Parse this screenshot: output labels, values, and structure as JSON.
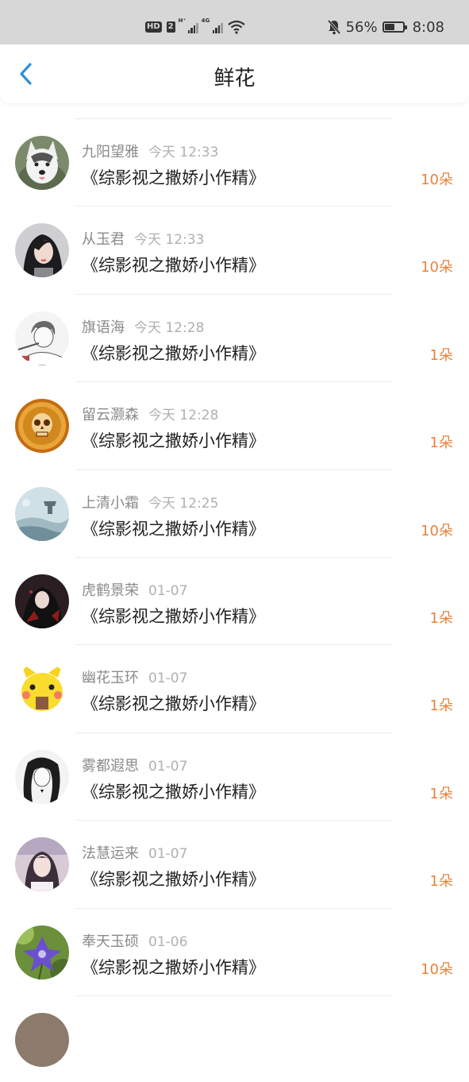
{
  "status_bar": {
    "hd_label": "HD",
    "hd_sub": "2",
    "signal_a_label": "H⁺",
    "signal_b_label": "4G",
    "battery_text": "56%",
    "battery_level": 0.56,
    "time": "8:08",
    "icons": [
      "hd-icon",
      "signal-icon",
      "wifi-icon",
      "mute-bell-icon",
      "battery-icon"
    ]
  },
  "header": {
    "title": "鲜花",
    "back_icon": "chevron-left-icon",
    "accent_color": "#2d8fe0"
  },
  "amount_color": "#e8833a",
  "entries": [
    {
      "name": "九阳望雅",
      "time": "今天 12:33",
      "book": "《综影视之撒娇小作精》",
      "amount": "10朵",
      "avatar": "husky-dog"
    },
    {
      "name": "从玉君",
      "time": "今天 12:33",
      "book": "《综影视之撒娇小作精》",
      "amount": "10朵",
      "avatar": "girl-portrait"
    },
    {
      "name": "旗语海",
      "time": "今天 12:28",
      "book": "《综影视之撒娇小作精》",
      "amount": "1朵",
      "avatar": "sketch-boy"
    },
    {
      "name": "留云灏森",
      "time": "今天 12:28",
      "book": "《综影视之撒娇小作精》",
      "amount": "1朵",
      "avatar": "golden-skull"
    },
    {
      "name": "上清小霜",
      "time": "今天 12:25",
      "book": "《综影视之撒娇小作精》",
      "amount": "10朵",
      "avatar": "misty-landscape"
    },
    {
      "name": "虎鹤景荣",
      "time": "01-07",
      "book": "《综影视之撒娇小作精》",
      "amount": "1朵",
      "avatar": "dark-ancient-figure"
    },
    {
      "name": "幽花玉环",
      "time": "01-07",
      "book": "《综影视之撒娇小作精》",
      "amount": "1朵",
      "avatar": "yellow-cartoon"
    },
    {
      "name": "雾都遐思",
      "time": "01-07",
      "book": "《综影视之撒娇小作精》",
      "amount": "1朵",
      "avatar": "bw-sketch-girl"
    },
    {
      "name": "法慧运来",
      "time": "01-07",
      "book": "《综影视之撒娇小作精》",
      "amount": "1朵",
      "avatar": "girl-photo"
    },
    {
      "name": "奉天玉硕",
      "time": "01-06",
      "book": "《综影视之撒娇小作精》",
      "amount": "10朵",
      "avatar": "purple-flower"
    }
  ]
}
